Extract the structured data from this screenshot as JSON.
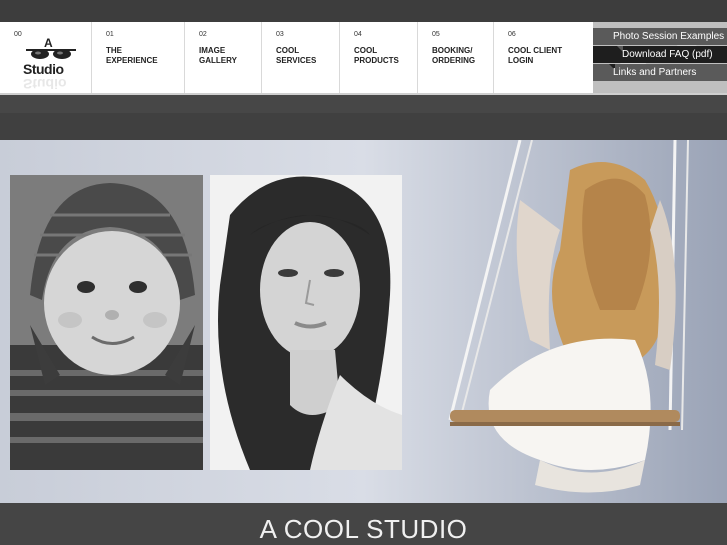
{
  "logo": {
    "num": "00",
    "line1": "A",
    "line2": "COOL",
    "line3": "Studio"
  },
  "nav": [
    {
      "num": "01",
      "label": "THE\nEXPERIENCE"
    },
    {
      "num": "02",
      "label": "IMAGE\nGALLERY"
    },
    {
      "num": "03",
      "label": "COOL\nSERVICES"
    },
    {
      "num": "04",
      "label": "COOL\nPRODUCTS"
    },
    {
      "num": "05",
      "label": "BOOKING/\nORDERING"
    },
    {
      "num": "06",
      "label": "COOL CLIENT\nLOGIN"
    }
  ],
  "side_links": [
    {
      "label": "Photo Session Examples"
    },
    {
      "label": "Download FAQ (pdf)"
    },
    {
      "label": "Links and Partners"
    }
  ],
  "footer": {
    "title": "A COOL STUDIO"
  }
}
